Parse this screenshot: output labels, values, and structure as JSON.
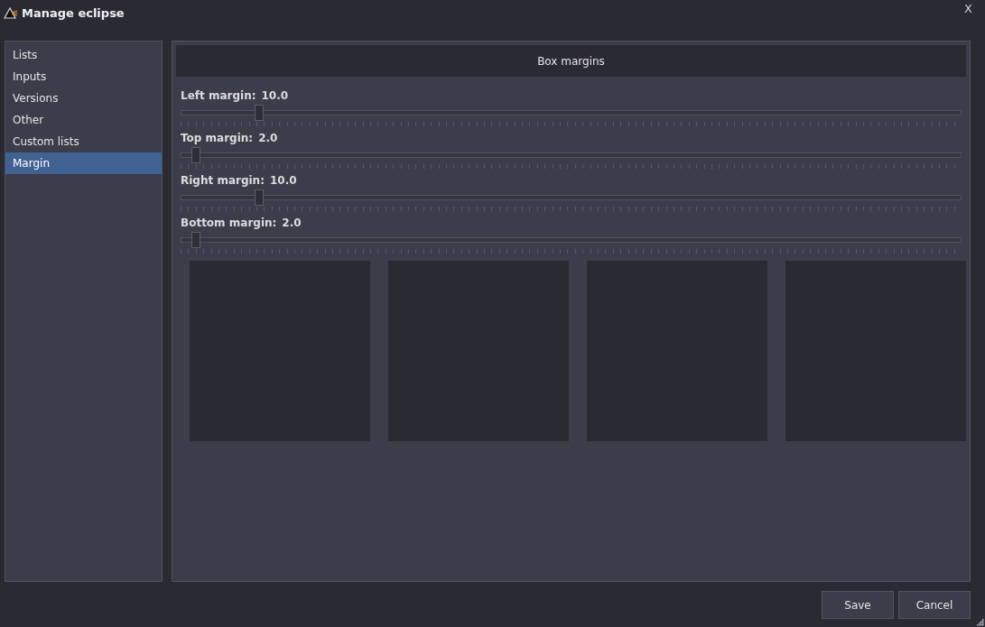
{
  "window": {
    "title": "Manage eclipse",
    "close": "X"
  },
  "sidebar": {
    "items": [
      {
        "label": "Lists",
        "selected": false
      },
      {
        "label": "Inputs",
        "selected": false
      },
      {
        "label": "Versions",
        "selected": false
      },
      {
        "label": "Other",
        "selected": false
      },
      {
        "label": "Custom lists",
        "selected": false
      },
      {
        "label": "Margin",
        "selected": true
      }
    ]
  },
  "panel": {
    "title": "Box margins",
    "sliders": [
      {
        "label": "Left margin:",
        "reading": "10.0",
        "level": 0.1
      },
      {
        "label": "Top margin:",
        "reading": "2.0",
        "level": 0.02
      },
      {
        "label": "Right margin:",
        "reading": "10.0",
        "level": 0.1
      },
      {
        "label": "Bottom margin:",
        "reading": "2.0",
        "level": 0.02
      }
    ]
  },
  "buttons": [
    "Save",
    "Cancel"
  ]
}
